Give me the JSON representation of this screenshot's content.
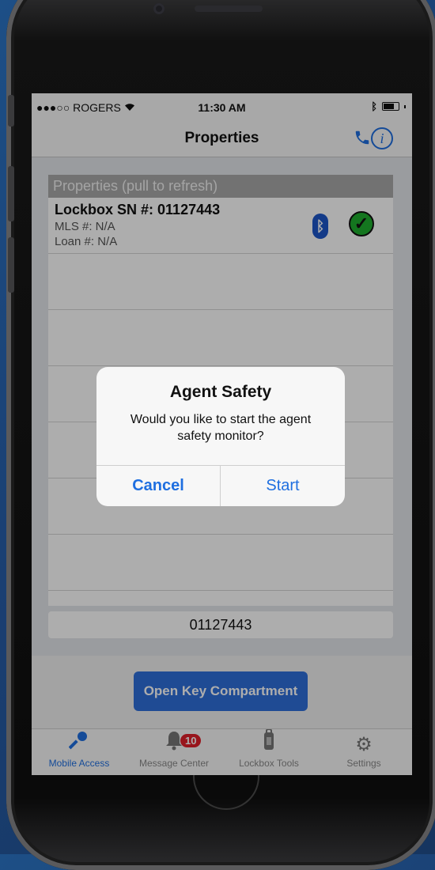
{
  "status_bar": {
    "carrier": "●●●○○ ROGERS",
    "time": "11:30 AM"
  },
  "nav": {
    "title": "Properties"
  },
  "list": {
    "header": "Properties (pull to refresh)",
    "items": [
      {
        "title": "Lockbox SN #: 01127443",
        "mls": "MLS #: N/A",
        "loan": "Loan #: N/A",
        "status_icon": "check-icon",
        "connection_icon": "bluetooth-icon"
      }
    ]
  },
  "serial_field": "01127443",
  "open_button": "Open Key Compartment",
  "tabs": [
    {
      "label": "Mobile Access",
      "icon": "key-icon",
      "active": true
    },
    {
      "label": "Message Center",
      "icon": "bell-icon",
      "badge": "10"
    },
    {
      "label": "Lockbox Tools",
      "icon": "lockbox-icon"
    },
    {
      "label": "Settings",
      "icon": "gear-icon"
    }
  ],
  "alert": {
    "title": "Agent Safety",
    "message": "Would you like to start the agent safety monitor?",
    "cancel_label": "Cancel",
    "start_label": "Start"
  },
  "colors": {
    "accent": "#1f6fe0",
    "badge": "#e0202a",
    "check": "#1eae2e",
    "list_header": "#a9a9a9"
  }
}
